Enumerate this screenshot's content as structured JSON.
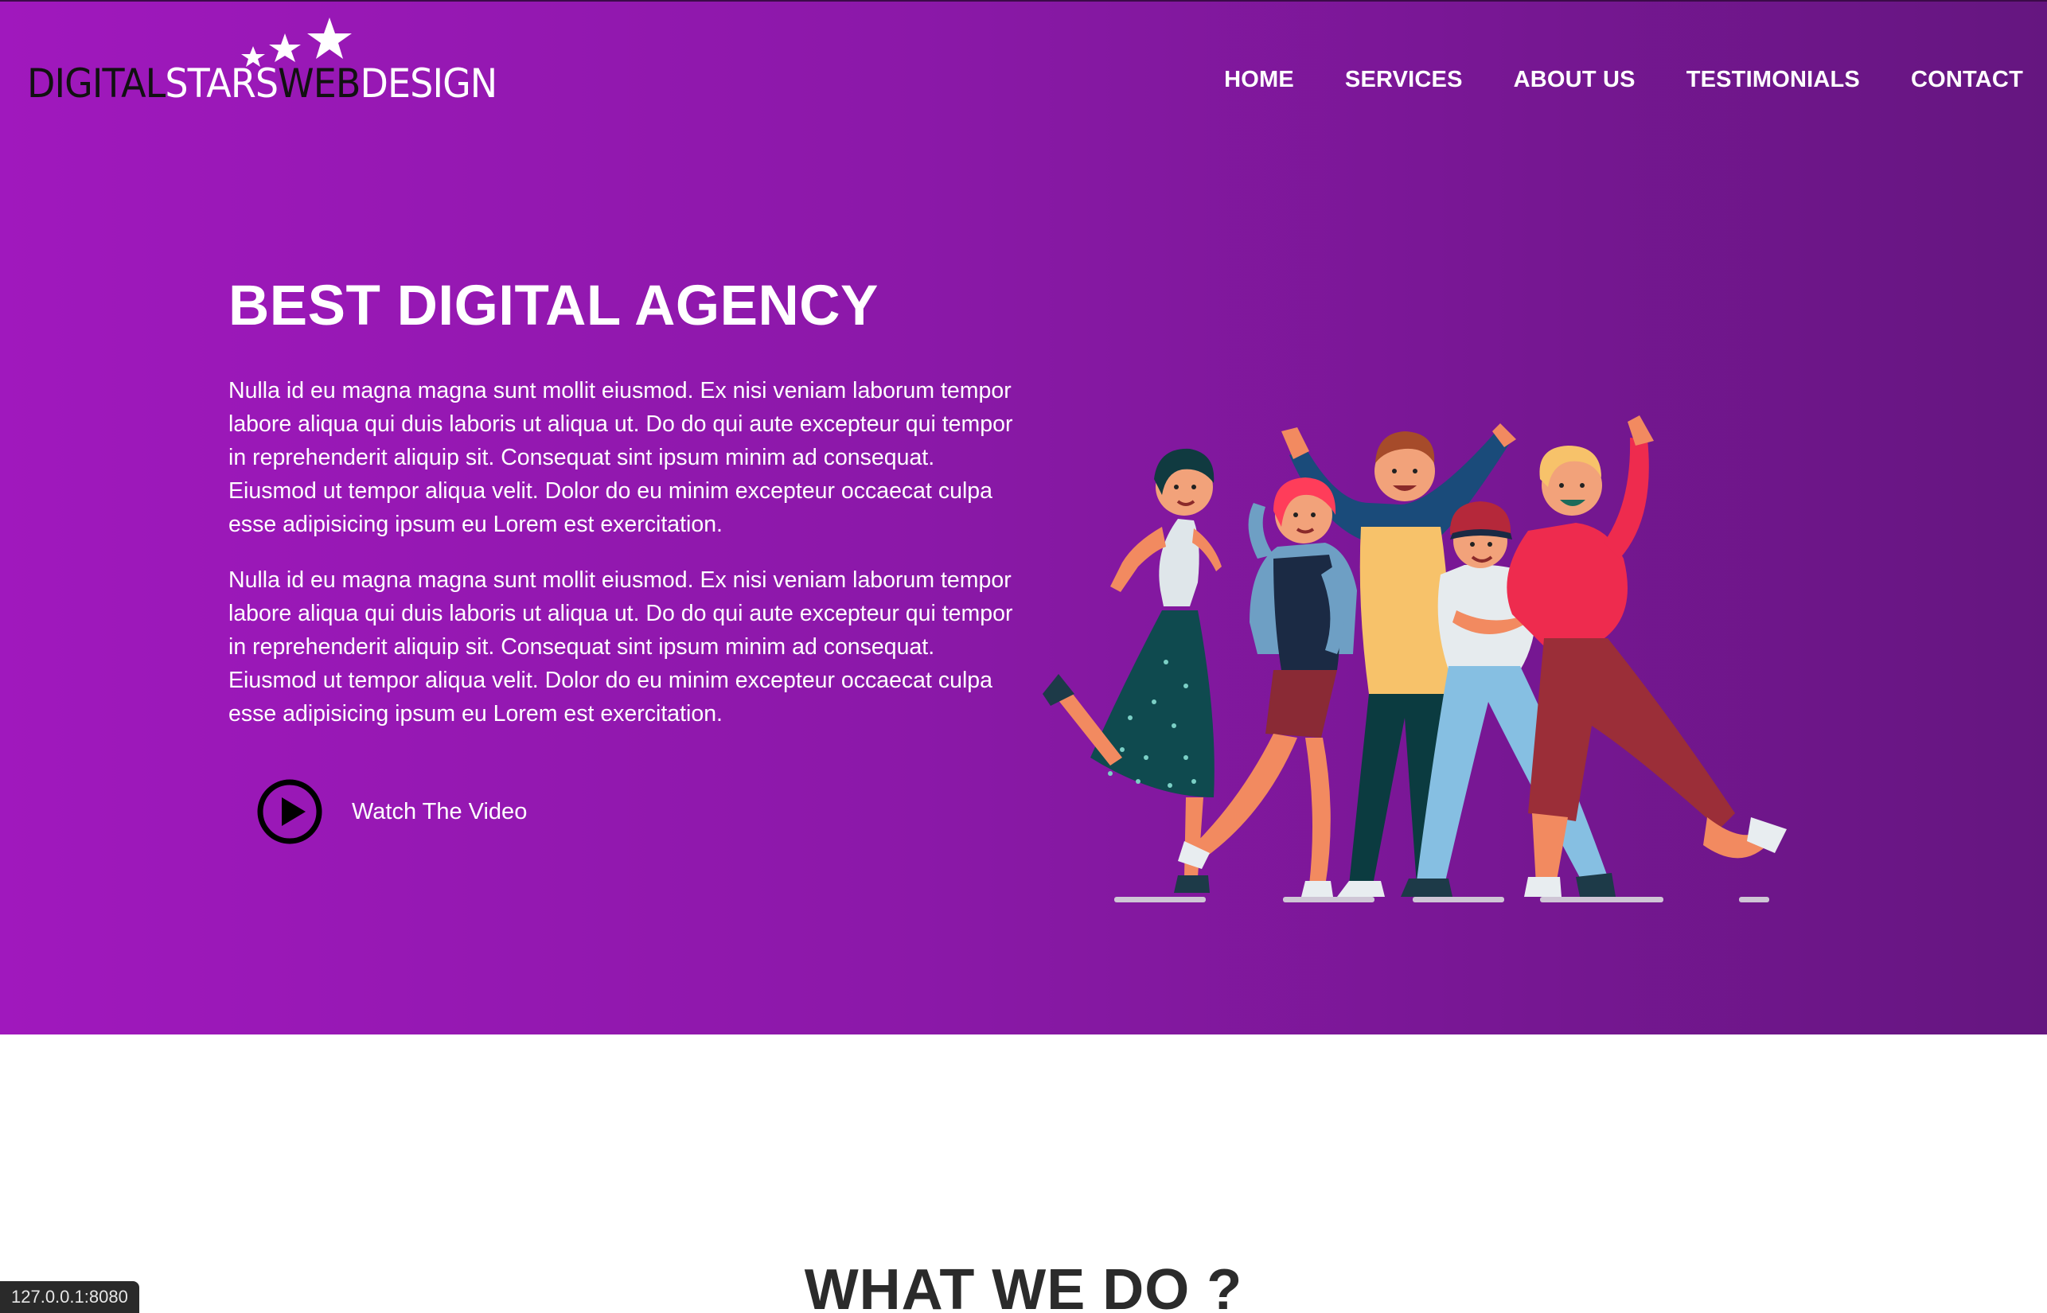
{
  "logo": {
    "part1": "DIGITAL",
    "part2": "STARS",
    "part3": "WEB",
    "part4": "DESIGN",
    "icon": "stars-icon"
  },
  "nav": {
    "items": [
      {
        "label": "HOME"
      },
      {
        "label": "SERVICES"
      },
      {
        "label": "ABOUT US"
      },
      {
        "label": "TESTIMONIALS"
      },
      {
        "label": "CONTACT"
      }
    ]
  },
  "hero": {
    "title": "BEST DIGITAL AGENCY",
    "paragraphs": [
      "Nulla id eu magna magna sunt mollit eiusmod. Ex nisi veniam laborum tempor labore aliqua qui duis laboris ut aliqua ut. Do do qui aute excepteur qui tempor in reprehenderit aliquip sit. Consequat sint ipsum minim ad consequat. Eiusmod ut tempor aliqua velit. Dolor do eu minim excepteur occaecat culpa esse adipisicing ipsum eu Lorem est exercitation.",
      "Nulla id eu magna magna sunt mollit eiusmod. Ex nisi veniam laborum tempor labore aliqua qui duis laboris ut aliqua ut. Do do qui aute excepteur qui tempor in reprehenderit aliquip sit. Consequat sint ipsum minim ad consequat. Eiusmod ut tempor aliqua velit. Dolor do eu minim excepteur occaecat culpa esse adipisicing ipsum eu Lorem est exercitation."
    ],
    "video_label": "Watch The Video",
    "video_icon": "play-circle-icon",
    "illustration": "happy-group-illustration"
  },
  "section": {
    "title": "WHAT WE DO ?"
  },
  "status_bar": {
    "url": "127.0.0.1:8080"
  },
  "colors": {
    "gradient_start": "#a018bd",
    "gradient_end": "#651680",
    "text_light": "#ffffff"
  }
}
